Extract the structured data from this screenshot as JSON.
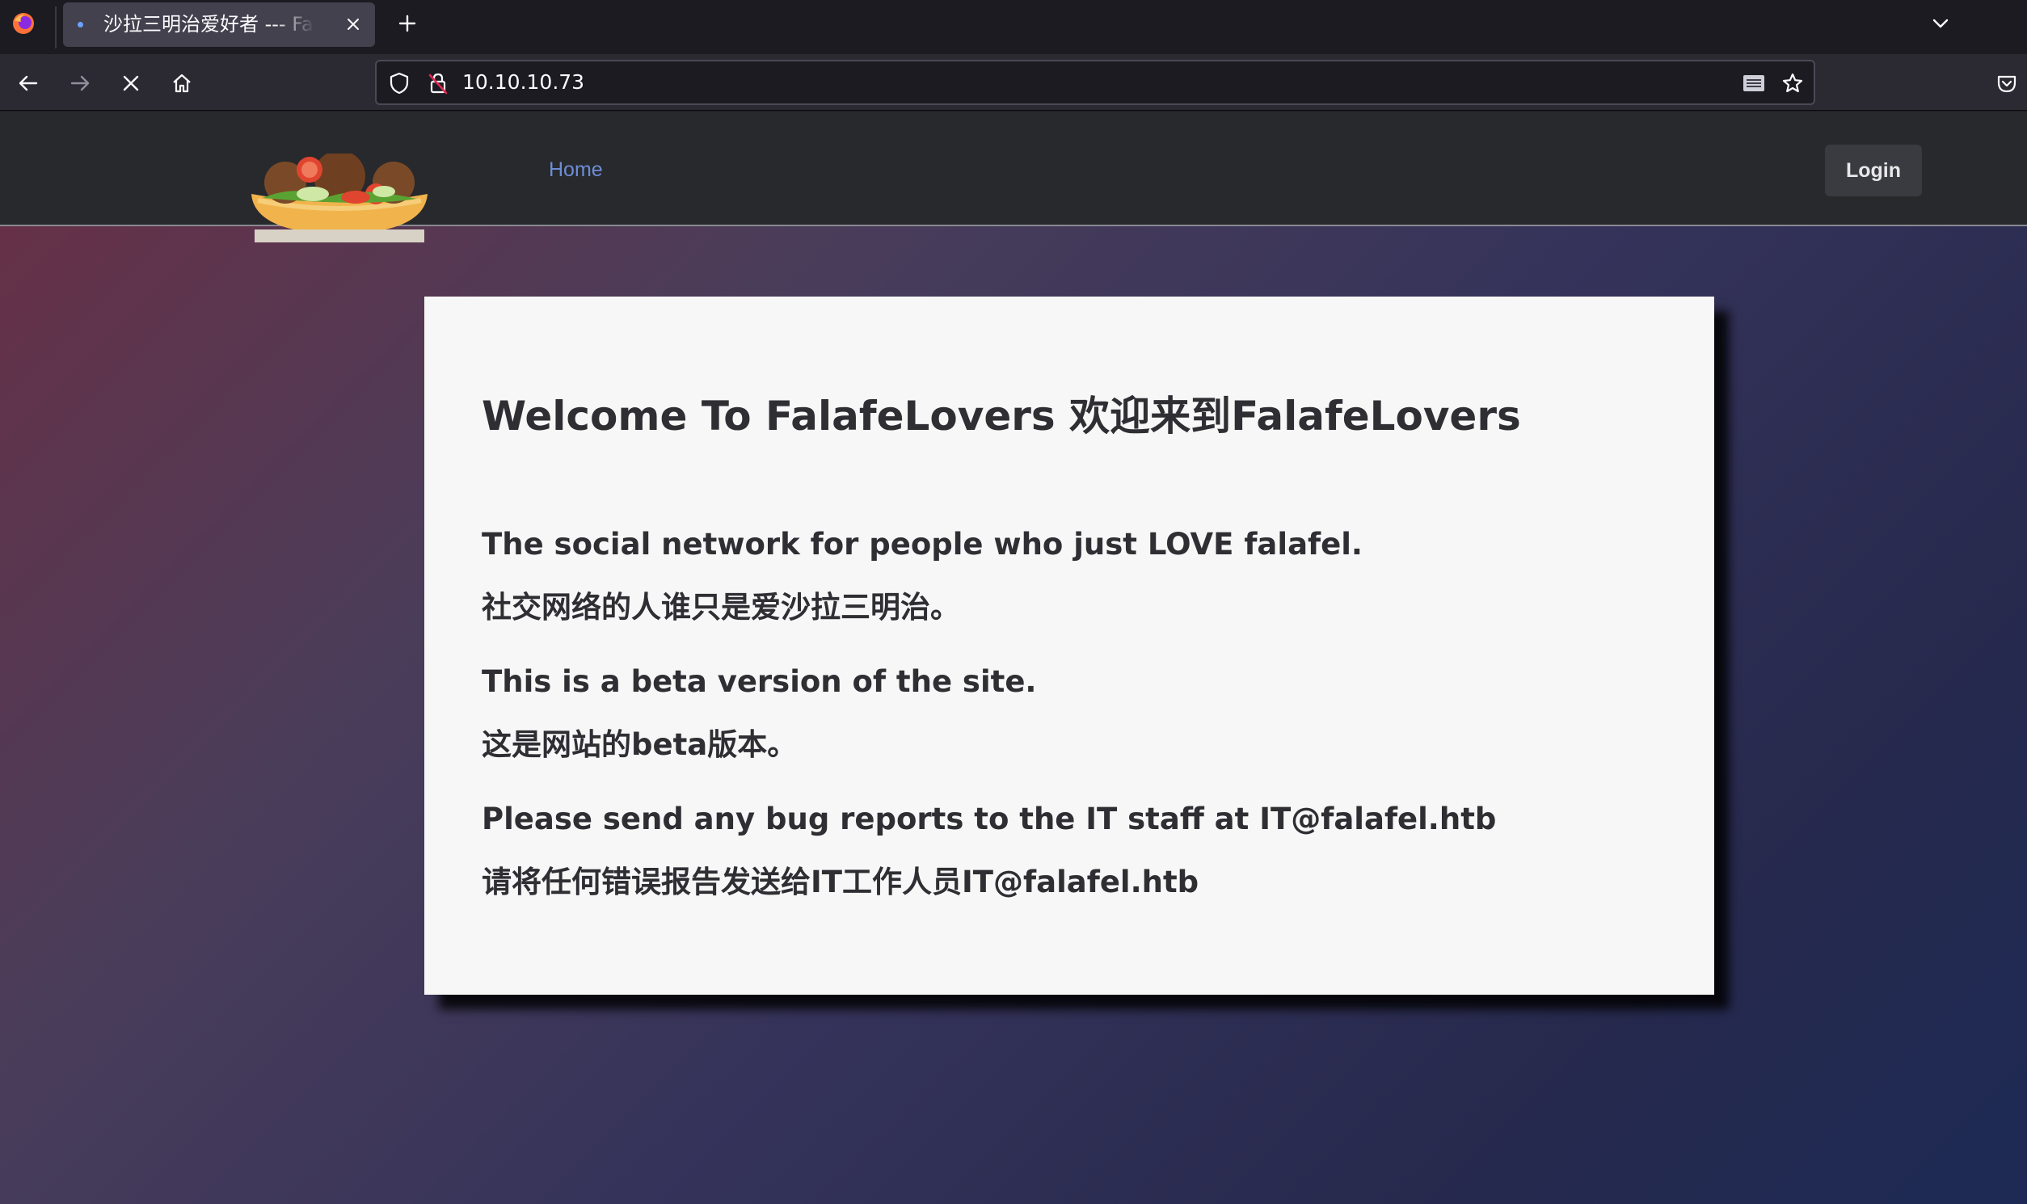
{
  "browser": {
    "tab": {
      "title": "沙拉三明治爱好者 --- Falafel Lovers"
    },
    "address_bar": {
      "url": "10.10.10.73"
    },
    "icons": {
      "browser_logo": "firefox-logo",
      "close_tab": "close-icon",
      "new_tab": "plus-icon",
      "tab_list": "chevron-down-icon",
      "back": "arrow-left-icon",
      "forward": "arrow-right-icon",
      "stop": "close-icon",
      "home": "home-icon",
      "tracking_protection": "shield-icon",
      "insecure_connection": "lock-strikethrough-icon",
      "reader_view": "reader-view-icon",
      "bookmark": "star-icon",
      "pocket": "pocket-icon"
    },
    "colors": {
      "chrome_dark": "#1c1b22",
      "toolbar": "#2b2a33",
      "active_tab": "#42414d"
    }
  },
  "site": {
    "header": {
      "nav_home": "Home",
      "login_label": "Login"
    },
    "welcome": {
      "title": "Welcome To FalafeLovers 欢迎来到FalafeLovers",
      "line1_en": "The social network for people who just LOVE falafel.",
      "line1_zh": "社交网络的人谁只是爱沙拉三明治。",
      "line2_en": "This is a beta version of the site.",
      "line2_zh": "这是网站的beta版本。",
      "line3_en": "Please send any bug reports to the IT staff at IT@falafel.htb",
      "line3_zh": "请将任何错误报告发送给IT工作人员IT@falafel.htb"
    },
    "colors": {
      "header_bg": "#28292d",
      "link": "#6d8ed6",
      "card_bg": "#f7f7f7",
      "text": "#2e2e33"
    }
  }
}
